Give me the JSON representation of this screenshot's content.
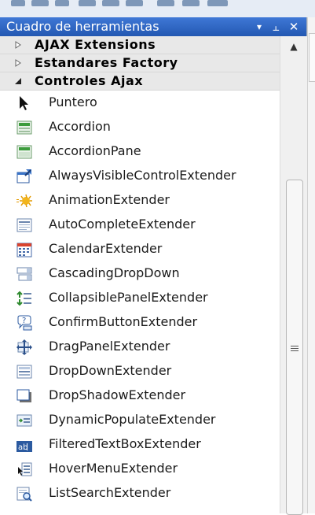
{
  "toolbox": {
    "title": "Cuadro de herramientas",
    "dropdown_glyph": "▾",
    "pin_glyph": "⫠",
    "close_glyph": "✕",
    "categories": [
      {
        "label": "AJAX Extensions",
        "expanded": false
      },
      {
        "label": "Estandares Factory",
        "expanded": false
      },
      {
        "label": "Controles Ajax",
        "expanded": true
      }
    ],
    "items": [
      {
        "label": "Puntero",
        "icon": "pointer-icon"
      },
      {
        "label": "Accordion",
        "icon": "accordion-icon"
      },
      {
        "label": "AccordionPane",
        "icon": "accordion-pane-icon"
      },
      {
        "label": "AlwaysVisibleControlExtender",
        "icon": "always-visible-icon"
      },
      {
        "label": "AnimationExtender",
        "icon": "animation-icon"
      },
      {
        "label": "AutoCompleteExtender",
        "icon": "autocomplete-icon"
      },
      {
        "label": "CalendarExtender",
        "icon": "calendar-icon"
      },
      {
        "label": "CascadingDropDown",
        "icon": "cascading-dropdown-icon"
      },
      {
        "label": "CollapsiblePanelExtender",
        "icon": "collapsible-panel-icon"
      },
      {
        "label": "ConfirmButtonExtender",
        "icon": "confirm-button-icon"
      },
      {
        "label": "DragPanelExtender",
        "icon": "drag-panel-icon"
      },
      {
        "label": "DropDownExtender",
        "icon": "dropdown-extender-icon"
      },
      {
        "label": "DropShadowExtender",
        "icon": "drop-shadow-icon"
      },
      {
        "label": "DynamicPopulateExtender",
        "icon": "dynamic-populate-icon"
      },
      {
        "label": "FilteredTextBoxExtender",
        "icon": "filtered-textbox-icon"
      },
      {
        "label": "HoverMenuExtender",
        "icon": "hover-menu-icon"
      },
      {
        "label": "ListSearchExtender",
        "icon": "list-search-icon"
      }
    ],
    "scroll_up_glyph": "▲"
  }
}
